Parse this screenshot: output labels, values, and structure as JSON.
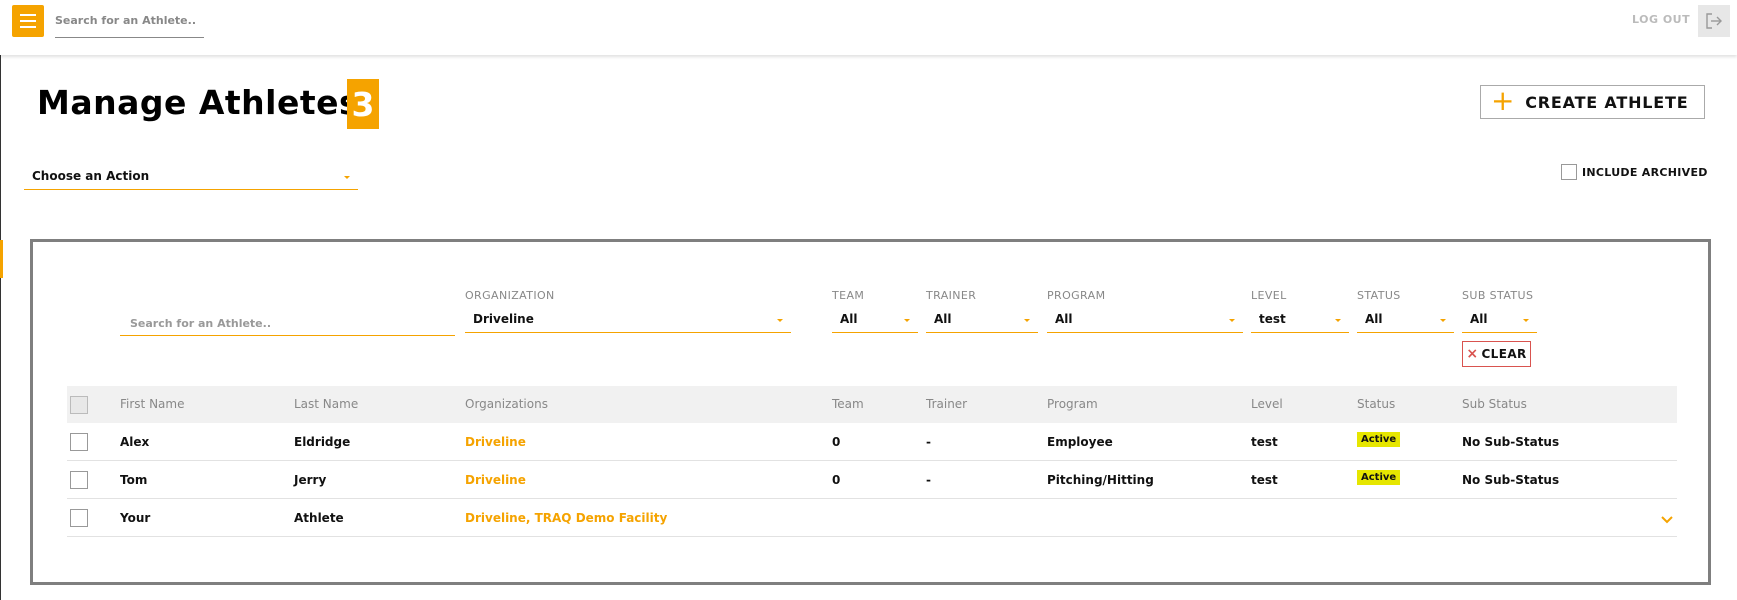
{
  "topbar": {
    "search_placeholder": "Search for an Athlete..",
    "logout_label": "LOG OUT"
  },
  "page": {
    "title": "Manage Athletes",
    "count": "3",
    "create_label": "CREATE ATHLETE",
    "action_select": "Choose an Action",
    "include_archived": "INCLUDE ARCHIVED"
  },
  "filters": {
    "search_placeholder": "Search for an Athlete..",
    "organization": {
      "label": "ORGANIZATION",
      "value": "Driveline"
    },
    "team": {
      "label": "TEAM",
      "value": "All"
    },
    "trainer": {
      "label": "TRAINER",
      "value": "All"
    },
    "program": {
      "label": "PROGRAM",
      "value": "All"
    },
    "level": {
      "label": "LEVEL",
      "value": "test"
    },
    "status": {
      "label": "STATUS",
      "value": "All"
    },
    "sub_status": {
      "label": "SUB STATUS",
      "value": "All"
    },
    "clear_label": "CLEAR"
  },
  "table": {
    "headers": {
      "first_name": "First Name",
      "last_name": "Last Name",
      "organizations": "Organizations",
      "team": "Team",
      "trainer": "Trainer",
      "program": "Program",
      "level": "Level",
      "status": "Status",
      "sub_status": "Sub Status"
    },
    "rows": [
      {
        "first": "Alex",
        "last": "Eldridge",
        "org": "Driveline",
        "team": "0",
        "trainer": "-",
        "program": "Employee",
        "level": "test",
        "status": "Active",
        "sub_status": "No Sub-Status"
      },
      {
        "first": "Tom",
        "last": "Jerry",
        "org": "Driveline",
        "team": "0",
        "trainer": "-",
        "program": "Pitching/Hitting",
        "level": "test",
        "status": "Active",
        "sub_status": "No Sub-Status"
      },
      {
        "first": "Your",
        "last": "Athlete",
        "org": "Driveline, TRAQ Demo Facility"
      }
    ]
  },
  "colors": {
    "accent": "#f5a300",
    "active_badge": "#e6e600",
    "clear_border": "#d9534f"
  },
  "icons": {
    "menu": "hamburger-icon",
    "logout": "logout-icon",
    "create": "plus-icon",
    "clear": "x-icon",
    "expand": "chevron-down-icon"
  }
}
